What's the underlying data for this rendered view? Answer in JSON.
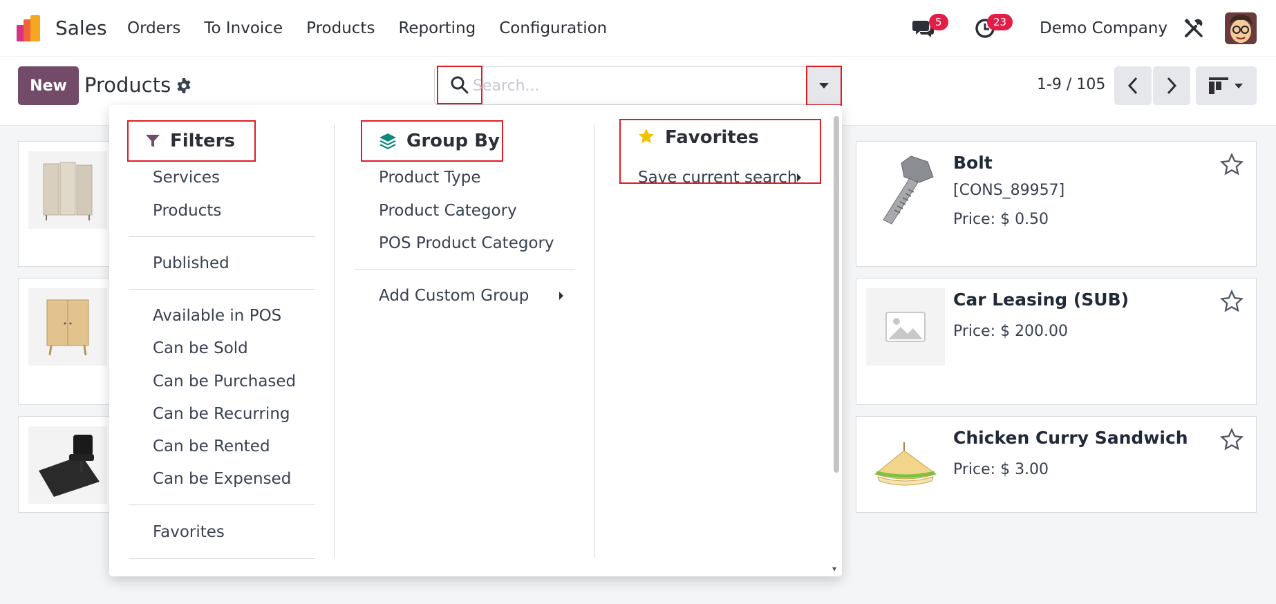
{
  "navbar": {
    "app_name": "Sales",
    "menu": [
      "Orders",
      "To Invoice",
      "Products",
      "Reporting",
      "Configuration"
    ],
    "messages_count": "5",
    "activities_count": "23",
    "company": "Demo Company"
  },
  "control": {
    "new_label": "New",
    "title": "Products",
    "search_placeholder": "Search...",
    "pager": "1-9 / 105"
  },
  "cards": [
    {
      "name": "Bolt",
      "code": "[CONS_89957]",
      "price": "Price: $ 0.50"
    },
    {
      "name": "Car Leasing (SUB)",
      "price": "Price: $ 200.00"
    },
    {
      "name": "Chicken Curry Sandwich",
      "price": "Price: $ 3.00"
    }
  ],
  "dropdown": {
    "filters": {
      "title": "Filters",
      "items": [
        "Services",
        "Products",
        "Published",
        "Available in POS",
        "Can be Sold",
        "Can be Purchased",
        "Can be Recurring",
        "Can be Rented",
        "Can be Expensed",
        "Favorites"
      ]
    },
    "group_by": {
      "title": "Group By",
      "items": [
        "Product Type",
        "Product Category",
        "POS Product Category"
      ],
      "custom": "Add Custom Group"
    },
    "favorites": {
      "title": "Favorites",
      "save": "Save current search"
    }
  },
  "colors": {
    "brand": "#714b67",
    "badge": "#e11d48",
    "highlight": "#e01b24",
    "groupby_icon": "#0e8a7a",
    "favorites_star": "#f2c200"
  }
}
